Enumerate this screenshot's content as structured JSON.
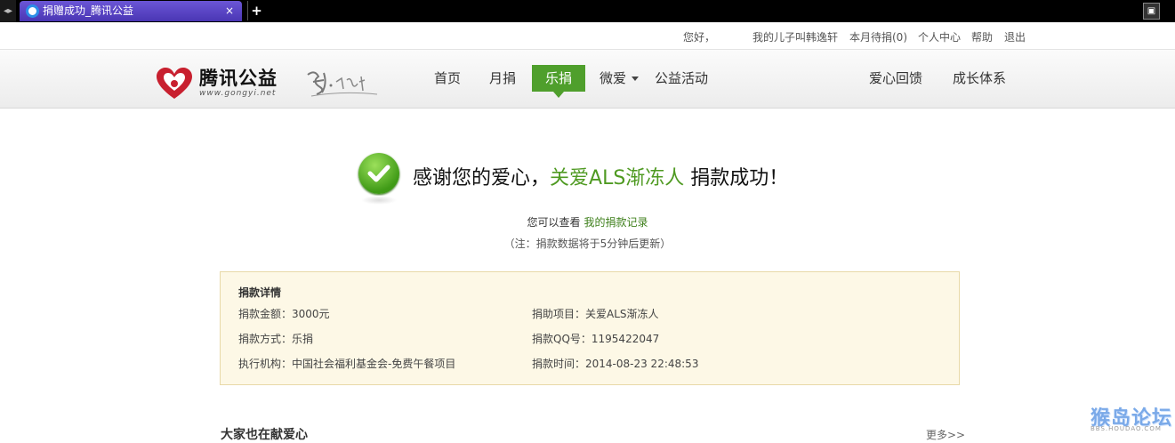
{
  "browser": {
    "tab_title": "捐赠成功_腾讯公益",
    "close_glyph": "×",
    "new_tab_glyph": "+"
  },
  "top_links": {
    "greeting": "您好，",
    "username": "我的儿子叫韩逸轩",
    "monthly_pending": "本月待捐(0)",
    "personal_center": "个人中心",
    "help": "帮助",
    "logout": "退出"
  },
  "header": {
    "logo_text": "腾讯公益",
    "logo_url": "www.gongyi.net",
    "nav": [
      {
        "label": "首页"
      },
      {
        "label": "月捐"
      },
      {
        "label": "乐捐",
        "active": true
      },
      {
        "label": "微爱"
      },
      {
        "label": "公益活动"
      }
    ],
    "nav_right": [
      {
        "label": "爱心回馈"
      },
      {
        "label": "成长体系"
      }
    ]
  },
  "success": {
    "prefix": "感谢您的爱心，",
    "project": "关爱ALS渐冻人",
    "suffix": " 捐款成功！",
    "view_text": "您可以查看",
    "records_link": "我的捐款记录",
    "note": "（注：捐款数据将于5分钟后更新）"
  },
  "details": {
    "title": "捐款详情",
    "rows": [
      {
        "left": "捐款金额：3000元",
        "right": "捐助项目：关爱ALS渐冻人"
      },
      {
        "left": "捐款方式：乐捐",
        "right": "捐款QQ号：1195422047"
      },
      {
        "left": "执行机构：中国社会福利基金会-免费午餐项目",
        "right": "捐款时间：2014-08-23 22:48:53"
      }
    ]
  },
  "bottom": {
    "section_title": "大家也在献爱心",
    "more": "更多>>"
  },
  "watermark": {
    "text": "猴岛论坛",
    "url": "BBS.HOUDAO.COM"
  },
  "colors": {
    "accent_green": "#4f9f2c",
    "tab_purple": "#5a45c8",
    "details_bg": "#fdf8e6"
  }
}
